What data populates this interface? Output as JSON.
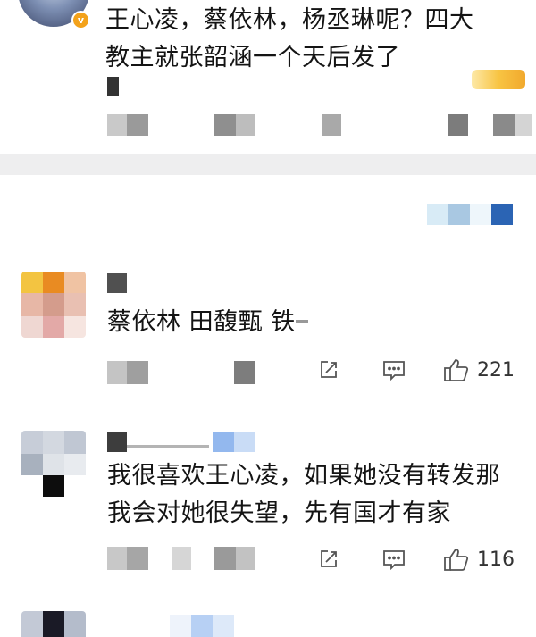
{
  "comments": [
    {
      "text_lines": [
        "王心凌，蔡依林，杨丞琳呢？四大",
        "教主就张韶涵一个天后发了"
      ],
      "verified_badge": "v"
    },
    {
      "text": "蔡依林  田馥甄  铁",
      "likes": "221"
    },
    {
      "text_lines": [
        "我很喜欢王心凌，如果她没有转发那",
        "我会对她很失望，先有国才有家"
      ],
      "likes": "116"
    }
  ],
  "icons": [
    "share-icon",
    "comment-icon",
    "like-icon"
  ]
}
